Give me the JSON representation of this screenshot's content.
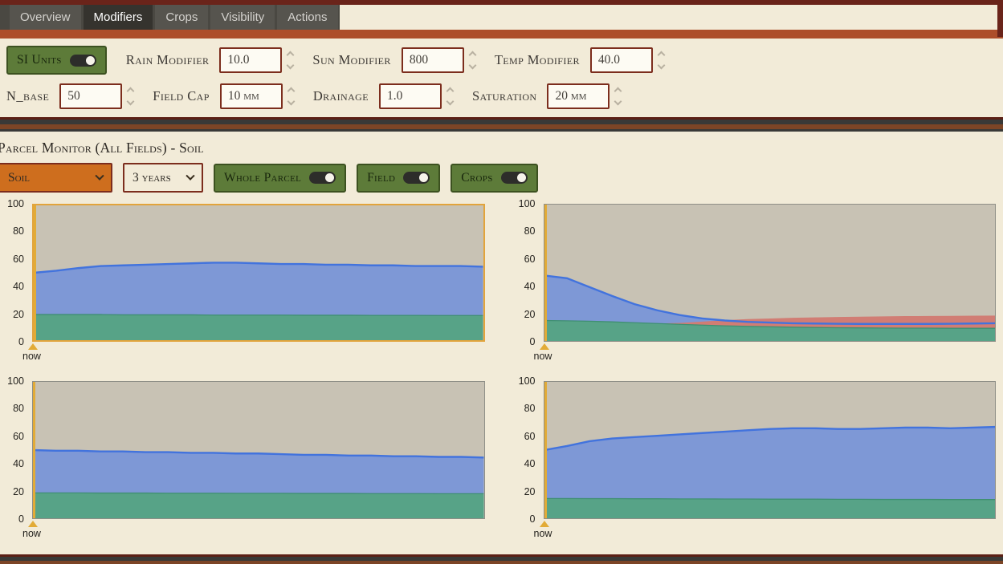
{
  "tabs": {
    "items": [
      {
        "label": "Overview",
        "active": false
      },
      {
        "label": "Modifiers",
        "active": true
      },
      {
        "label": "Crops",
        "active": false
      },
      {
        "label": "Visibility",
        "active": false
      },
      {
        "label": "Actions",
        "active": false
      }
    ]
  },
  "modifiers": {
    "si_units": {
      "label": "SI Units",
      "on": true
    },
    "row1": [
      {
        "label": "Rain Modifier",
        "value": "10.0"
      },
      {
        "label": "Sun Modifier",
        "value": "800"
      },
      {
        "label": "Temp Modifier",
        "value": "40.0"
      }
    ],
    "row2": [
      {
        "label": "N_base",
        "value": "50"
      },
      {
        "label": "Field Cap",
        "value": "10 mm"
      },
      {
        "label": "Drainage",
        "value": "1.0"
      },
      {
        "label": "Saturation",
        "value": "20 mm"
      }
    ]
  },
  "monitor": {
    "title": "Parcel Monitor (All Fields) - Soil",
    "metric_select": {
      "value": "Soil"
    },
    "range_select": {
      "value": "3 years"
    },
    "toggles": [
      {
        "label": "Whole Parcel",
        "on": true
      },
      {
        "label": "Field",
        "on": true
      },
      {
        "label": "Crops",
        "on": true
      }
    ]
  },
  "colors": {
    "chart_bg": "#c8c2b4",
    "blue_fill": "#7e98d6",
    "blue_line": "#4273dd",
    "green_fill": "#57a387",
    "green_line": "#3f8f72",
    "red_fill": "#d17d74",
    "highlight_border": "#e2a43c",
    "now_marker": "#e2ab37",
    "accent_orange": "#ad4e2a",
    "accent_maroon": "#6a241a",
    "button_green": "#5d7b39",
    "select_orange": "#ce6e1e",
    "input_border": "#7c2d1d"
  },
  "chart_data": [
    {
      "type": "area",
      "position": "top-left",
      "highlighted": true,
      "ylim": [
        0,
        100
      ],
      "yticks": [
        100,
        80,
        60,
        40,
        20,
        0
      ],
      "now_label": "now",
      "blue_values": [
        50,
        51.5,
        53.5,
        55,
        55.5,
        56,
        56.5,
        57,
        57.5,
        57.5,
        57,
        56.5,
        56.5,
        56,
        56,
        55.5,
        55.5,
        55,
        55,
        55,
        54.5
      ],
      "green_values": [
        19,
        19,
        19,
        19,
        18.8,
        18.8,
        18.8,
        18.8,
        18.6,
        18.6,
        18.6,
        18.6,
        18.5,
        18.5,
        18.5,
        18.4,
        18.4,
        18.4,
        18.3,
        18.3,
        18.3
      ],
      "red_top_values": null
    },
    {
      "type": "area",
      "position": "top-right",
      "highlighted": false,
      "ylim": [
        0,
        100
      ],
      "yticks": [
        100,
        80,
        60,
        40,
        20,
        0
      ],
      "now_label": "now",
      "blue_values": [
        48,
        46,
        39.5,
        33,
        27,
        22.5,
        19,
        16.5,
        15,
        14,
        13.5,
        13,
        12.8,
        12.6,
        12.5,
        12.5,
        12.5,
        12.5,
        12.6,
        12.8,
        13
      ],
      "green_values": [
        15,
        14.8,
        14.5,
        14,
        13.4,
        12.8,
        12.2,
        11.6,
        11.1,
        10.7,
        10.4,
        10.1,
        9.9,
        9.7,
        9.6,
        9.5,
        9.4,
        9.4,
        9.3,
        9.3,
        9.3
      ],
      "red_top_values": [
        15,
        14.8,
        14.5,
        14,
        13.4,
        12.8,
        13.2,
        14.2,
        15.2,
        16,
        16.5,
        17,
        17.3,
        17.6,
        17.8,
        18,
        18.2,
        18.3,
        18.4,
        18.5,
        18.6
      ]
    },
    {
      "type": "area",
      "position": "bottom-left",
      "highlighted": false,
      "ylim": [
        0,
        100
      ],
      "yticks": [
        100,
        80,
        60,
        40,
        20,
        0
      ],
      "now_label": "now",
      "blue_values": [
        50,
        49.5,
        49.5,
        49,
        49,
        48.5,
        48.5,
        48,
        48,
        47.5,
        47.5,
        47,
        46.5,
        46.5,
        46,
        46,
        45.5,
        45.5,
        45,
        45,
        44.5
      ],
      "green_values": [
        18.6,
        18.6,
        18.6,
        18.5,
        18.5,
        18.5,
        18.4,
        18.4,
        18.4,
        18.3,
        18.3,
        18.3,
        18.2,
        18.2,
        18.2,
        18.1,
        18.1,
        18.1,
        18,
        18,
        18
      ],
      "red_top_values": null
    },
    {
      "type": "area",
      "position": "bottom-right",
      "highlighted": false,
      "ylim": [
        0,
        100
      ],
      "yticks": [
        100,
        80,
        60,
        40,
        20,
        0
      ],
      "now_label": "now",
      "blue_values": [
        50,
        53,
        56.5,
        58.5,
        59.5,
        60.5,
        61.5,
        62.5,
        63.5,
        64.5,
        65.5,
        66,
        66,
        65.5,
        65.5,
        66,
        66.5,
        66.5,
        66,
        66.5,
        67
      ],
      "green_values": [
        14.5,
        14.5,
        14.4,
        14.4,
        14.3,
        14.3,
        14.2,
        14.2,
        14.1,
        14.1,
        14,
        14,
        14,
        13.9,
        13.9,
        13.8,
        13.8,
        13.8,
        13.7,
        13.7,
        13.7
      ],
      "red_top_values": null
    }
  ]
}
